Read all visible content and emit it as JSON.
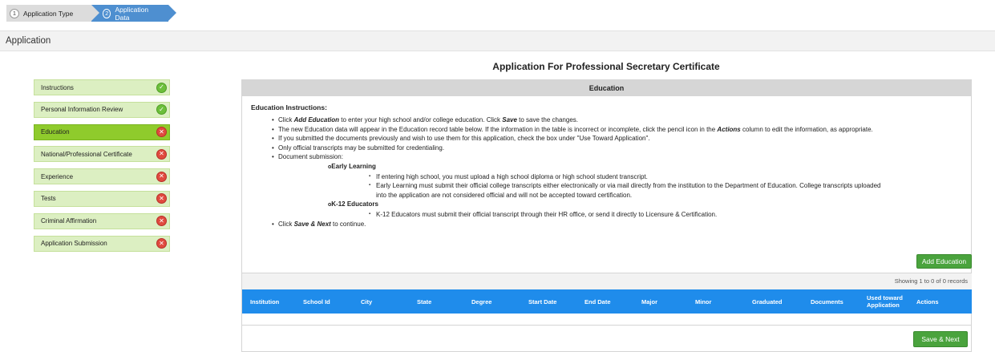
{
  "wizard": {
    "steps": [
      {
        "number": "1",
        "label": "Application Type"
      },
      {
        "number": "2",
        "label": "Application Data"
      }
    ]
  },
  "header": {
    "title": "Application"
  },
  "page_title": "Application For Professional Secretary Certificate",
  "sidebar": {
    "items": [
      {
        "label": "Instructions",
        "status": "complete"
      },
      {
        "label": "Personal Information Review",
        "status": "complete"
      },
      {
        "label": "Education",
        "status": "incomplete",
        "active": true
      },
      {
        "label": "National/Professional Certificate",
        "status": "incomplete"
      },
      {
        "label": "Experience",
        "status": "incomplete"
      },
      {
        "label": "Tests",
        "status": "incomplete"
      },
      {
        "label": "Criminal Affirmation",
        "status": "incomplete"
      },
      {
        "label": "Application Submission",
        "status": "incomplete"
      }
    ]
  },
  "panel": {
    "title": "Education",
    "instructions_title": "Education Instructions:",
    "lines": {
      "l1_a": "Click ",
      "l1_b": "Add Education",
      "l1_c": " to enter your high school and/or college education. Click ",
      "l1_d": "Save",
      "l1_e": " to save the changes.",
      "l2_a": "The new Education data will appear in the Education record table below. If the information in the table is incorrect or incomplete, click the pencil icon in the ",
      "l2_b": "Actions",
      "l2_c": " column to edit the information, as appropriate.",
      "l3": "If you submitted the documents previously and wish to use them for this application, check the box under \"Use Toward Application\".",
      "l4": "Only official transcripts may be submitted for credentialing.",
      "l5": "Document submission:",
      "early_learning": "Early Learning",
      "el_1": "If entering high school, you must upload a high school diploma or high school student transcript.",
      "el_2": "Early Learning must submit their official college transcripts either electronically or via mail directly from the institution to the Department of Education.  College transcripts uploaded",
      "el_2b": "into the application are not considered official and will not be accepted toward certification.",
      "k12": "K-12 Educators",
      "k12_1": "K-12 Educators must submit their official transcript through their HR office, or send it directly to Licensure & Certification.",
      "l6_a": "Click ",
      "l6_b": "Save & Next",
      "l6_c": " to continue."
    },
    "add_button": "Add Education",
    "save_button": "Save & Next",
    "table": {
      "info": "Showing 1 to 0 of 0 records",
      "columns": [
        "Institution",
        "School Id",
        "City",
        "State",
        "Degree",
        "Start Date",
        "End Date",
        "Major",
        "Minor",
        "Graduated",
        "Documents",
        "Used toward Application",
        "Actions"
      ]
    }
  },
  "colors": {
    "step_active": "#4e8fd0",
    "sidebar_item": "#dcefc2",
    "sidebar_active": "#8fcb2c",
    "status_ok": "#6cbf3b",
    "status_error": "#e04a3f",
    "button_green": "#4aa33d",
    "table_header": "#1f8ceb"
  },
  "icons": {
    "complete": "check-circle-icon",
    "incomplete": "x-circle-icon"
  }
}
